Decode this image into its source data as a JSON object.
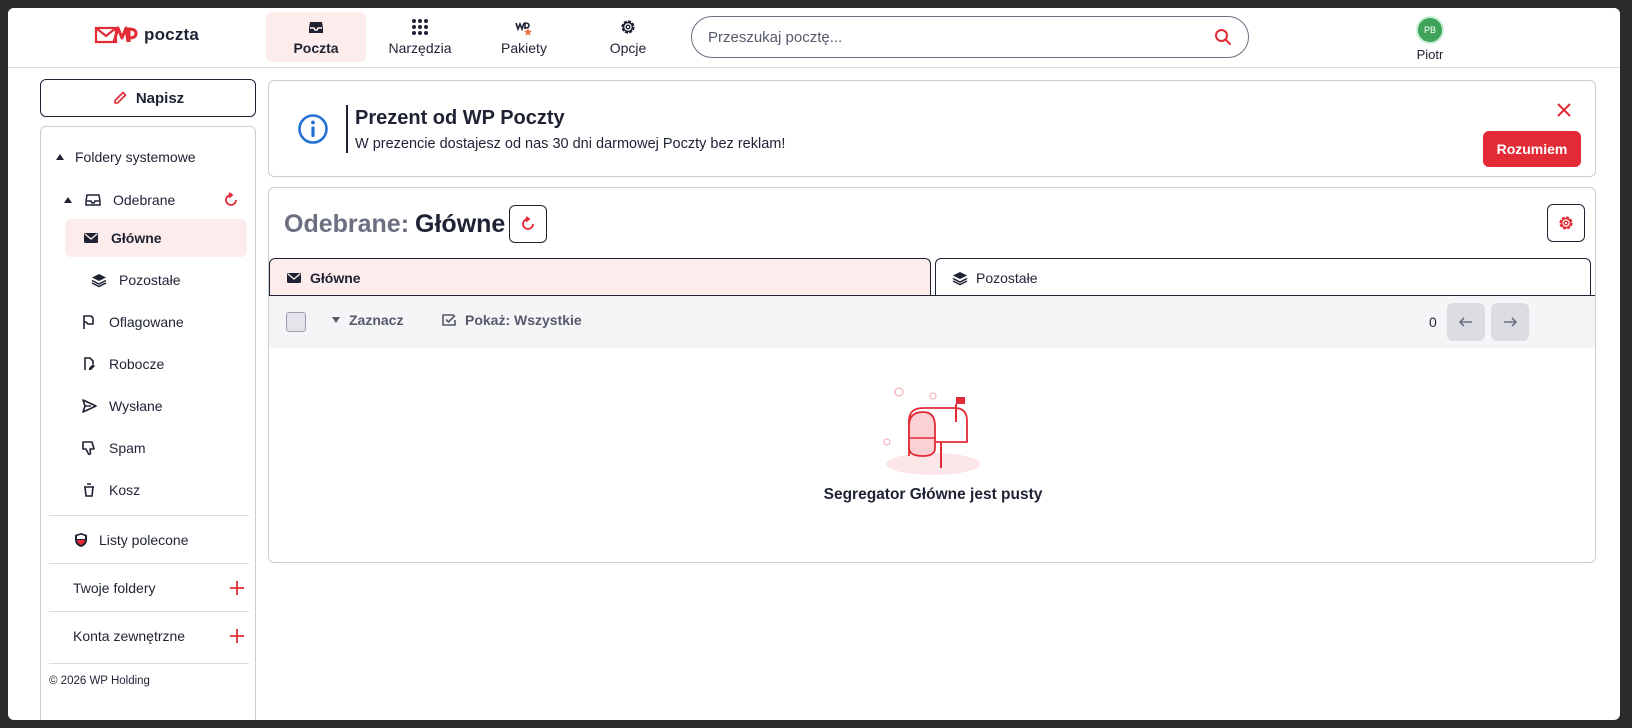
{
  "header": {
    "logo_text": "poczta",
    "nav": [
      {
        "label": "Poczta",
        "icon": "inbox-icon",
        "active": true
      },
      {
        "label": "Narzędzia",
        "icon": "grid-icon",
        "active": false
      },
      {
        "label": "Pakiety",
        "icon": "wp-packages-icon",
        "active": false
      },
      {
        "label": "Opcje",
        "icon": "gear-icon",
        "active": false
      }
    ],
    "search_placeholder": "Przeszukaj pocztę...",
    "user": {
      "initials": "PB",
      "name": "Piotr"
    }
  },
  "sidebar": {
    "compose_label": "Napisz",
    "system_folders_label": "Foldery systemowe",
    "inbox_label": "Odebrane",
    "items": [
      {
        "label": "Główne",
        "icon": "envelope-icon",
        "active": true
      },
      {
        "label": "Pozostałe",
        "icon": "layers-icon",
        "active": false
      },
      {
        "label": "Oflagowane",
        "icon": "flag-icon",
        "active": false
      },
      {
        "label": "Robocze",
        "icon": "draft-icon",
        "active": false
      },
      {
        "label": "Wysłane",
        "icon": "send-icon",
        "active": false
      },
      {
        "label": "Spam",
        "icon": "thumbs-down-icon",
        "active": false
      },
      {
        "label": "Kosz",
        "icon": "trash-icon",
        "active": false
      }
    ],
    "registered_letters_label": "Listy polecone",
    "your_folders_label": "Twoje foldery",
    "external_accounts_label": "Konta zewnętrzne",
    "footer": "© 2026 WP Holding"
  },
  "banner": {
    "title": "Prezent od WP Poczty",
    "text": "W prezencie dostajesz od nas 30 dni darmowej Poczty bez reklam!",
    "button_label": "Rozumiem"
  },
  "main": {
    "title_prefix": "Odebrane:",
    "title_main": "Główne",
    "tabs": [
      {
        "label": "Główne",
        "icon": "envelope-icon",
        "active": true
      },
      {
        "label": "Pozostałe",
        "icon": "layers-icon",
        "active": false
      }
    ],
    "toolbar": {
      "select_label": "Zaznacz",
      "show_label": "Pokaż: Wszystkie",
      "count": "0"
    },
    "empty_message": "Segregator Główne jest pusty"
  },
  "colors": {
    "accent": "#e22b37",
    "active_bg": "#fdecec",
    "text": "#1e2233",
    "info_blue": "#2471d6"
  }
}
